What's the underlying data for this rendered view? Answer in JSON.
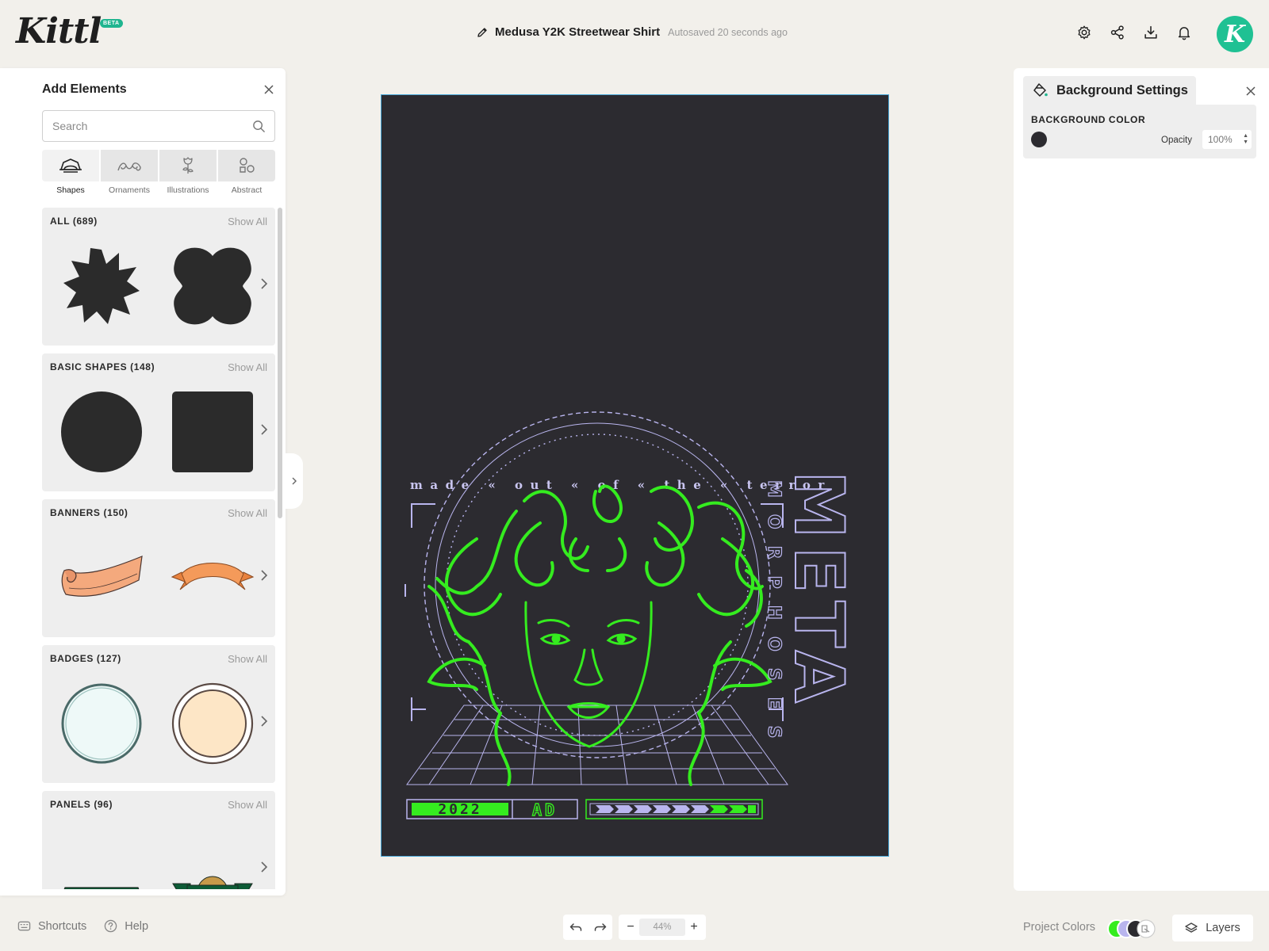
{
  "app": {
    "logo": "Kittl",
    "badge": "BETA"
  },
  "header": {
    "doc_title": "Medusa Y2K Streetwear Shirt",
    "autosave": "Autosaved 20 seconds ago",
    "icons": [
      "gear-icon",
      "share-icon",
      "download-icon",
      "bell-icon"
    ],
    "avatar_letter": "K",
    "accent_color": "#1fc193"
  },
  "rail": {
    "icons": [
      "edit-icon",
      "template-icon",
      "text-icon",
      "elements-icon",
      "upload-icon",
      "camera-icon",
      "pattern-icon"
    ]
  },
  "add_elements": {
    "title": "Add Elements",
    "search_placeholder": "Search",
    "tabs": [
      {
        "label": "Shapes",
        "icon": "shapes-icon",
        "active": true
      },
      {
        "label": "Ornaments",
        "icon": "ornaments-icon",
        "active": false
      },
      {
        "label": "Illustrations",
        "icon": "illustrations-icon",
        "active": false
      },
      {
        "label": "Abstract",
        "icon": "abstract-icon",
        "active": false
      }
    ],
    "show_all": "Show All",
    "sections": [
      {
        "title": "ALL (689)"
      },
      {
        "title": "BASIC SHAPES (148)"
      },
      {
        "title": "BANNERS (150)"
      },
      {
        "title": "BADGES (127)"
      },
      {
        "title": "PANELS (96)"
      }
    ]
  },
  "canvas": {
    "background": "#2c2b30",
    "artwork": {
      "tagline": "made « out « of « the « terror",
      "big_word": "META",
      "vertical_word": "MORPHOSES",
      "year": "2022",
      "era": "AD",
      "line_color": "#35ec1f",
      "accent_color": "#b9b5ee"
    }
  },
  "background_settings": {
    "title": "Background Settings",
    "color_label": "BACKGROUND COLOR",
    "color": "#2c2b30",
    "opacity_label": "Opacity",
    "opacity_value": "100%"
  },
  "footer": {
    "shortcuts": "Shortcuts",
    "help": "Help",
    "zoom": "44%",
    "zoom_minus": "−",
    "zoom_plus": "+",
    "project_colors": "Project Colors",
    "project_color_swatches": [
      "#35ec1f",
      "#b9b5ee",
      "#2c2b30",
      "#ffffff"
    ],
    "layers": "Layers"
  }
}
